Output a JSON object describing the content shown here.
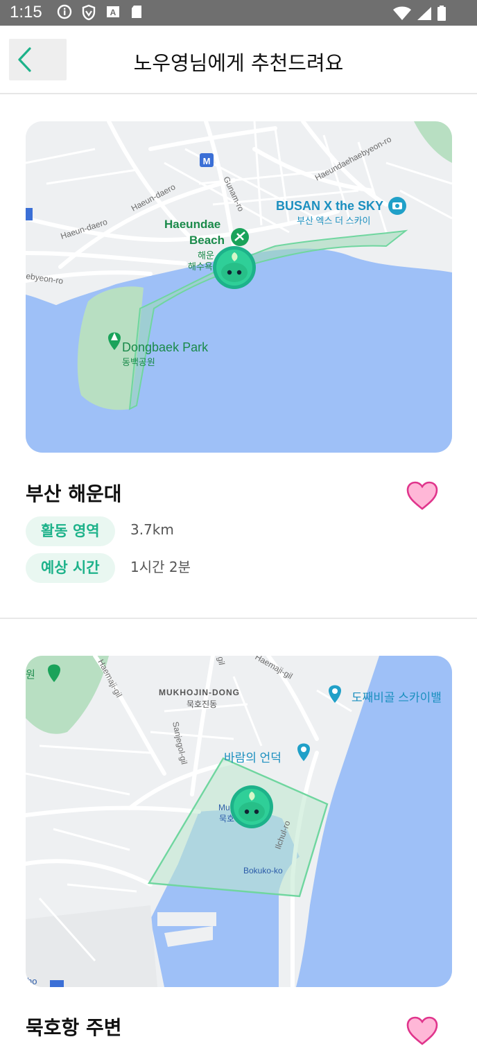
{
  "status_bar": {
    "time": "1:15",
    "icons_left": [
      "info-icon",
      "shield-icon",
      "keyboard-icon",
      "sd-card-icon"
    ],
    "icons_right": [
      "wifi-icon",
      "signal-icon",
      "battery-icon"
    ]
  },
  "app_bar": {
    "back_icon": "chevron-left-icon",
    "title": "노우영님에게 추천드려요"
  },
  "places": [
    {
      "name": "부산 해운대",
      "liked": true,
      "activity_area_label": "활동 영역",
      "activity_area_value": "3.7km",
      "expected_time_label": "예상 시간",
      "expected_time_value": "1시간 2분",
      "map": {
        "labels": {
          "busan_x_sky": "BUSAN X the SKY",
          "busan_x_sky_ko": "부산 엑스 더 스카이",
          "haeundae_beach_1": "Haeundae",
          "haeundae_beach_2": "Beach",
          "haeundae_ko_1": "해운",
          "haeundae_ko_2": "해수욕",
          "dongbaek_park": "Dongbaek Park",
          "dongbaek_park_ko": "동백공원",
          "haeun_daero_1": "Haeun-daero",
          "haeun_daero_2": "Haeun-daero",
          "gunam_ro": "Gunam-ro",
          "haeundaehaebyeon_ro": "Haeundaehaebyeon-ro",
          "haebyeon_ro": "ebyeon-ro"
        }
      }
    },
    {
      "name": "묵호항 주변",
      "liked": true,
      "map": {
        "labels": {
          "mukhojin_dong": "MUKHOJIN-DONG",
          "mukhojin_dong_ko": "묵호진동",
          "dojjaebigol": "도째비골 스카이밸",
          "wind_hill": "바람의 언덕",
          "bokuko": "Bokuko-ko",
          "haemaji_gil_1": "Haemaji-gil",
          "haemaji_gil_2": "Haemaji-gil",
          "sanjegol_gil": "Sanjegol-gil",
          "ilchul_ro": "Ilchul-ro",
          "park_frag": "원",
          "mu_frag": "Mu",
          "muk_frag": "묵호",
          "gil_frag": "gil",
          "ho_frag": "ho"
        }
      }
    }
  ]
}
